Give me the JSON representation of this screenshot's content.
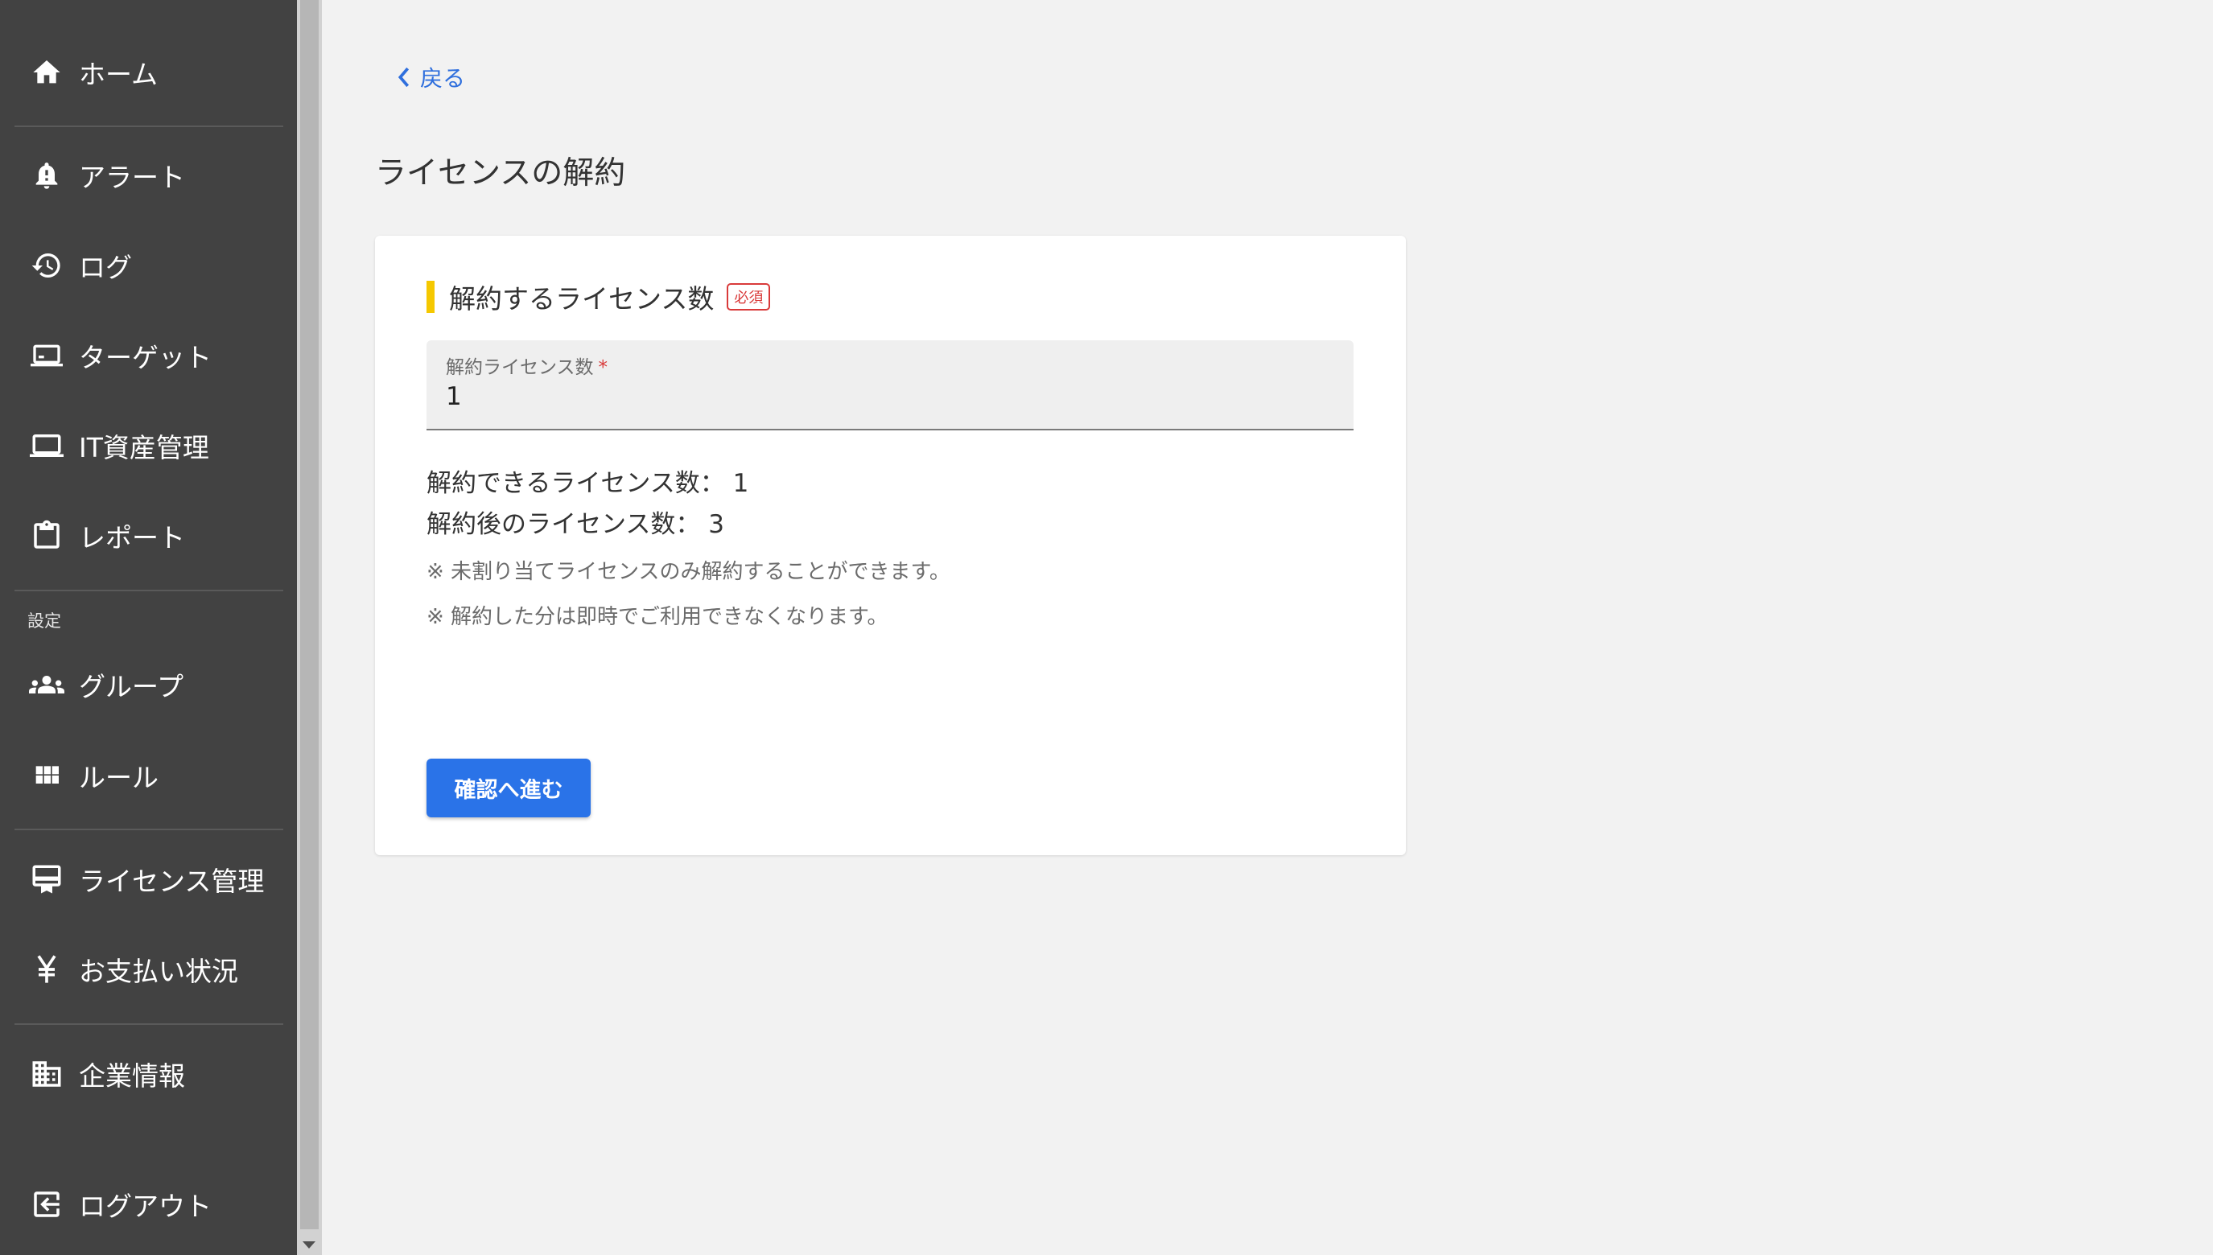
{
  "sidebar": {
    "items": [
      {
        "label": "ホーム",
        "icon": "home-icon"
      },
      {
        "label": "アラート",
        "icon": "bell-alert-icon"
      },
      {
        "label": "ログ",
        "icon": "history-icon"
      },
      {
        "label": "ターゲット",
        "icon": "target-device-icon"
      },
      {
        "label": "IT資産管理",
        "icon": "laptop-icon"
      },
      {
        "label": "レポート",
        "icon": "clipboard-icon"
      },
      {
        "label": "グループ",
        "icon": "group-icon"
      },
      {
        "label": "ルール",
        "icon": "grid-icon"
      },
      {
        "label": "ライセンス管理",
        "icon": "license-icon"
      },
      {
        "label": "お支払い状況",
        "icon": "yen-icon"
      },
      {
        "label": "企業情報",
        "icon": "building-icon"
      },
      {
        "label": "ログアウト",
        "icon": "logout-icon"
      }
    ],
    "section_settings": "設定"
  },
  "main": {
    "back_label": "戻る",
    "title": "ライセンスの解約",
    "card": {
      "heading": "解約するライセンス数",
      "required_badge": "必須",
      "field": {
        "label": "解約ライセンス数",
        "required_mark": "*",
        "value": "1"
      },
      "available_label": "解約できるライセンス数：",
      "available_value": "1",
      "after_label": "解約後のライセンス数：",
      "after_value": "3",
      "notes": [
        "※ 未割り当てライセンスのみ解約することができます。",
        "※ 解約した分は即時でご利用できなくなります。"
      ],
      "confirm_button": "確認へ進む"
    }
  },
  "colors": {
    "sidebar_bg": "#424242",
    "accent_blue": "#2a73e8",
    "heading_bar": "#f5c800",
    "required_red": "#d93a3a"
  }
}
